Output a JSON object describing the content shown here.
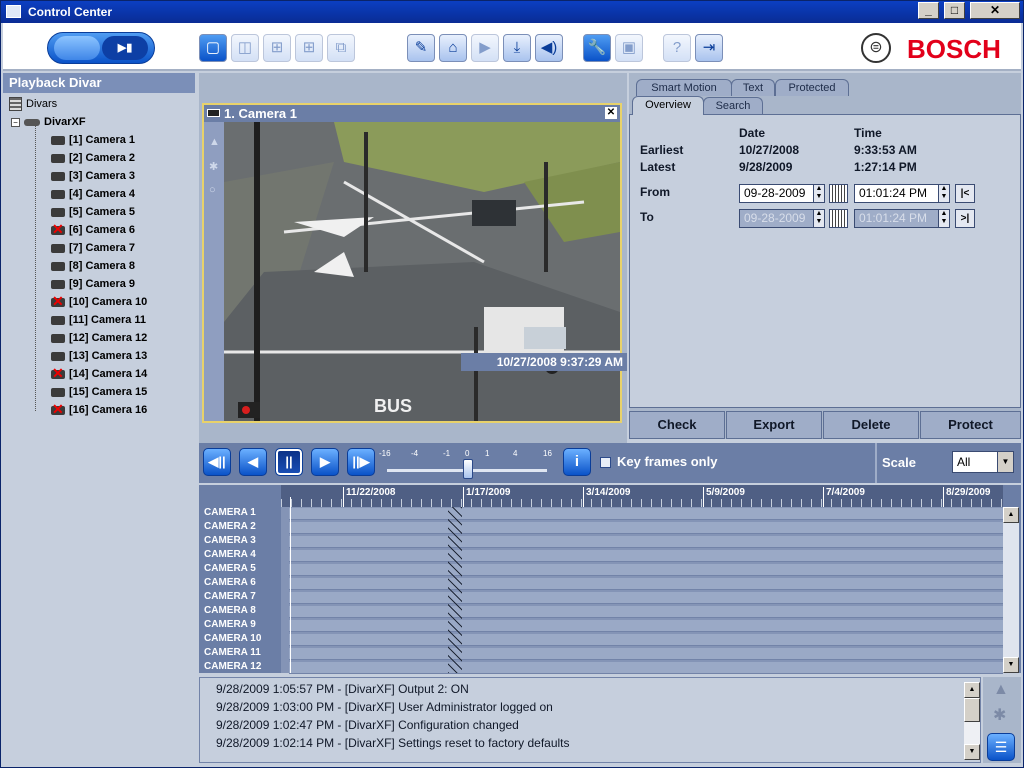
{
  "window": {
    "title": "Control Center",
    "minimize": "_",
    "maximize": "□",
    "close": "✕"
  },
  "toolbar": {
    "mode_live_icon": "live-icon",
    "mode_playback_icon": "playback-icon",
    "mode_playback_label": "▶▮",
    "tools": [
      "▢",
      "◫",
      "⊞",
      "⊞",
      "⧉",
      "✎",
      "⌂",
      "▶",
      "⤓",
      "◀)",
      "🔧",
      "▣",
      "?",
      "⇥"
    ]
  },
  "brand": {
    "name": "BOSCH",
    "logo_glyph": "⊜",
    "color": "#e2001a"
  },
  "tree": {
    "title": "Playback Divar",
    "root": "Divars",
    "device": "DivarXF",
    "expander": "−",
    "cameras": [
      {
        "label": "[1] Camera 1",
        "status": "ok"
      },
      {
        "label": "[2] Camera 2",
        "status": "ok"
      },
      {
        "label": "[3] Camera 3",
        "status": "ok"
      },
      {
        "label": "[4] Camera 4",
        "status": "ok"
      },
      {
        "label": "[5] Camera 5",
        "status": "ok"
      },
      {
        "label": "[6] Camera 6",
        "status": "off"
      },
      {
        "label": "[7] Camera 7",
        "status": "ok"
      },
      {
        "label": "[8] Camera 8",
        "status": "ok"
      },
      {
        "label": "[9] Camera 9",
        "status": "ok"
      },
      {
        "label": "[10] Camera 10",
        "status": "off"
      },
      {
        "label": "[11] Camera 11",
        "status": "ok"
      },
      {
        "label": "[12] Camera 12",
        "status": "ok"
      },
      {
        "label": "[13] Camera 13",
        "status": "ok"
      },
      {
        "label": "[14] Camera 14",
        "status": "off"
      },
      {
        "label": "[15] Camera 15",
        "status": "ok"
      },
      {
        "label": "[16] Camera 16",
        "status": "off"
      }
    ]
  },
  "video": {
    "title": "1. Camera 1",
    "close": "✕",
    "timestamp": "10/27/2008 9:37:29 AM",
    "scene_text": "BUS"
  },
  "tabs": {
    "row1": [
      "Smart Motion",
      "Text",
      "Protected"
    ],
    "row2": [
      "Overview",
      "Search"
    ]
  },
  "overview": {
    "date_header": "Date",
    "time_header": "Time",
    "earliest_label": "Earliest",
    "earliest_date": "10/27/2008",
    "earliest_time": "9:33:53 AM",
    "latest_label": "Latest",
    "latest_date": "9/28/2009",
    "latest_time": "1:27:14 PM",
    "from_label": "From",
    "from_date": "09-28-2009",
    "from_time": "01:01:24 PM",
    "to_label": "To",
    "to_date": "09-28-2009",
    "to_time": "01:01:24 PM",
    "go_start": "|<",
    "go_end": ">|"
  },
  "actions": [
    "Check",
    "Export",
    "Delete",
    "Protect"
  ],
  "transport": {
    "buttons": [
      "◀||",
      "◀",
      "||",
      "▶",
      "||▶"
    ],
    "speed_ticks": [
      "-16",
      "-4",
      "-1",
      "0",
      "1",
      "4",
      "16"
    ],
    "speed_value": 0,
    "info": "i",
    "keyframes_label": "Key frames only"
  },
  "scale": {
    "label": "Scale",
    "value": "All"
  },
  "timeline": {
    "dates": [
      "11/22/2008",
      "1/17/2009",
      "3/14/2009",
      "5/9/2009",
      "7/4/2009",
      "8/29/2009"
    ],
    "cameras": [
      "CAMERA 1",
      "CAMERA 2",
      "CAMERA 3",
      "CAMERA 4",
      "CAMERA 5",
      "CAMERA 6",
      "CAMERA 7",
      "CAMERA 8",
      "CAMERA 9",
      "CAMERA 10",
      "CAMERA 11",
      "CAMERA 12"
    ]
  },
  "log": {
    "lines": [
      "9/28/2009 1:05:57 PM - [DivarXF] Output 2: ON",
      "9/28/2009 1:03:00 PM - [DivarXF] User Administrator logged on",
      "9/28/2009 1:02:47 PM - [DivarXF] Configuration changed",
      "9/28/2009 1:02:14 PM - [DivarXF] Settings reset to factory defaults"
    ]
  }
}
